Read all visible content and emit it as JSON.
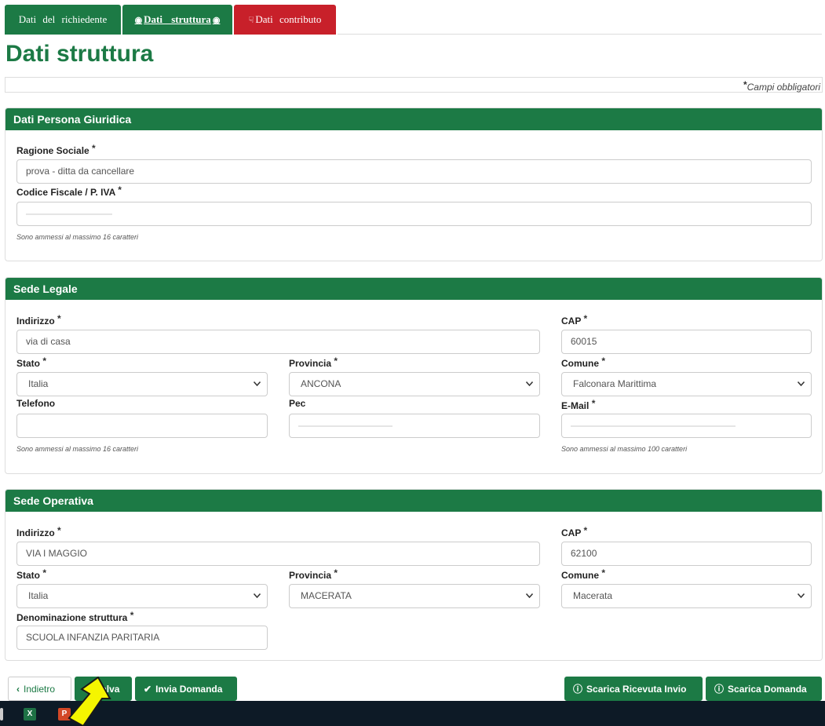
{
  "tabs": [
    {
      "label": "Dati del richiedente",
      "active": false
    },
    {
      "label": "Dati struttura",
      "active": true
    },
    {
      "label": "Dati contributo",
      "active": false
    }
  ],
  "page_title": "Dati struttura",
  "required_note": "Campi obbligatori",
  "required_marker": "*",
  "persona_giuridica": {
    "title": "Dati Persona Giuridica",
    "ragione_sociale_label": "Ragione Sociale",
    "ragione_sociale_value": "prova - ditta da cancellare",
    "codice_fiscale_label": "Codice Fiscale / P. IVA",
    "codice_fiscale_hint": "Sono ammessi al massimo 16 caratteri"
  },
  "sede_legale": {
    "title": "Sede Legale",
    "indirizzo_label": "Indirizzo",
    "indirizzo_value": "via di casa",
    "cap_label": "CAP",
    "cap_value": "60015",
    "stato_label": "Stato",
    "stato_value": "Italia",
    "provincia_label": "Provincia",
    "provincia_value": "ANCONA",
    "comune_label": "Comune",
    "comune_value": "Falconara Marittima",
    "telefono_label": "Telefono",
    "pec_label": "Pec",
    "email_label": "E-Mail",
    "telefono_hint": "Sono ammessi al massimo 16 caratteri",
    "email_hint": "Sono ammessi al massimo 100 caratteri"
  },
  "sede_operativa": {
    "title": "Sede Operativa",
    "indirizzo_label": "Indirizzo",
    "indirizzo_value": "VIA I MAGGIO",
    "cap_label": "CAP",
    "cap_value": "62100",
    "stato_label": "Stato",
    "stato_value": "Italia",
    "provincia_label": "Provincia",
    "provincia_value": "MACERATA",
    "comune_label": "Comune",
    "comune_value": "Macerata",
    "denominazione_label": "Denominazione struttura",
    "denominazione_value": "SCUOLA INFANZIA PARITARIA"
  },
  "buttons": {
    "indietro": "Indietro",
    "salva": "Salva",
    "invia": "Invia Domanda",
    "scarica_ricevuta": "Scarica Ricevuta Invio",
    "scarica_domanda": "Scarica Domanda"
  },
  "taskbar": {
    "excel_icon": "excel-icon",
    "powerpoint_icon": "powerpoint-icon"
  },
  "colors": {
    "primary_green": "#1c7a45",
    "tab_red": "#c8202a",
    "taskbar": "#0d1a26",
    "arrow_yellow": "#f5f500"
  }
}
